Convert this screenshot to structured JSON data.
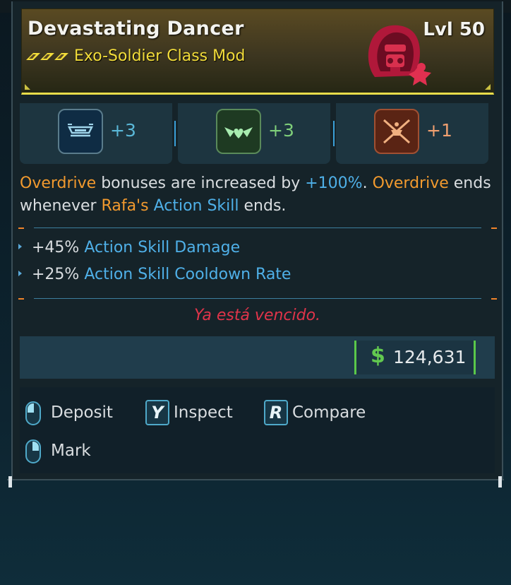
{
  "item": {
    "name": "Devastating Dancer",
    "level": "Lvl 50",
    "type": "Exo-Soldier Class Mod",
    "rarity_icon": "rarity-chevrons-icon",
    "class_icon": "exo-soldier-helmet-icon"
  },
  "skills": [
    {
      "icon": "blue-skill-icon",
      "bonus": "+3",
      "color": "#5ab8d8"
    },
    {
      "icon": "green-skill-icon",
      "bonus": "+3",
      "color": "#7fcf7a"
    },
    {
      "icon": "red-skill-icon",
      "bonus": "+1",
      "color": "#f0a070"
    }
  ],
  "description": {
    "part1": "Overdrive",
    "part2": " bonuses are increased by ",
    "part3": "+100%",
    "part4": ". ",
    "part5": "Overdrive",
    "part6": " ends whenever ",
    "part7": "Rafa's",
    "part8": " ",
    "part9": "Action Skill",
    "part10": " ends."
  },
  "stats": [
    {
      "value": "+45%",
      "name": "Action Skill Damage"
    },
    {
      "value": "+25%",
      "name": "Action Skill Cooldown Rate"
    }
  ],
  "flavor_text": "Ya está vencido.",
  "price": {
    "symbol": "$",
    "amount": "124,631"
  },
  "actions": {
    "deposit": "Deposit",
    "inspect_key": "Y",
    "inspect": "Inspect",
    "compare_key": "R",
    "compare": "Compare",
    "mark": "Mark"
  },
  "colors": {
    "rarity": "#f3dd3a",
    "orange": "#f29a2e",
    "blue": "#4fb0e8",
    "flavor": "#e0344a",
    "money": "#62c94f"
  }
}
